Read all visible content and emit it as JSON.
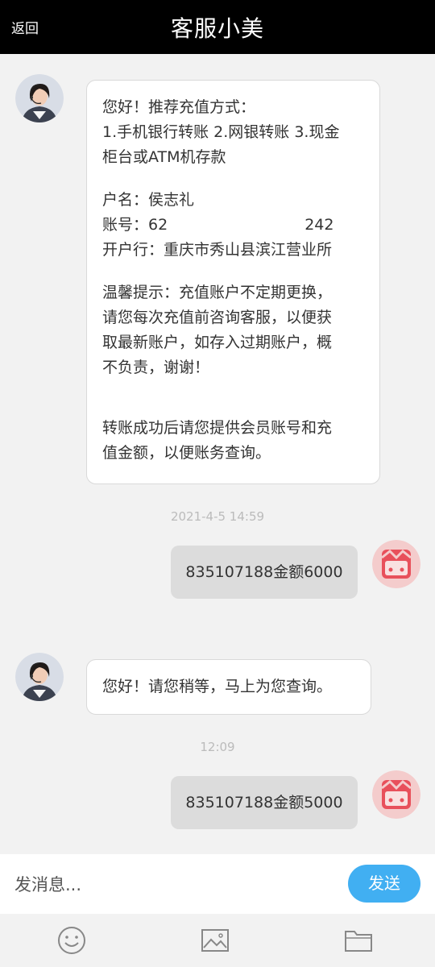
{
  "header": {
    "back_label": "返回",
    "title": "客服小美"
  },
  "messages": {
    "m1": {
      "greeting": "您好！推荐充值方式：",
      "methods_line1": "1.手机银行转账 2.网银转账 3.现金",
      "methods_line2": "柜台或ATM机存款",
      "account_name": "户名：侯志礼",
      "account_no_prefix": "账号：62",
      "account_no_suffix": "242",
      "bank": "开户行：重庆市秀山县滨江营业所",
      "tip_line1": "温馨提示：充值账户不定期更换，",
      "tip_line2": "请您每次充值前咨询客服，以便获",
      "tip_line3": "取最新账户，如存入过期账户，概",
      "tip_line4": "不负责，谢谢！",
      "after_line1": "转账成功后请您提供会员账号和充",
      "after_line2": "值金额，以便账务查询。"
    },
    "time1": "2021-4-5 14:59",
    "m2": "835107188金额6000",
    "m3": "您好！请您稍等，马上为您查询。",
    "time2": "12:09",
    "m4": "835107188金额5000"
  },
  "input": {
    "placeholder": "发消息...",
    "send_label": "发送"
  },
  "toolbar": {
    "icons": [
      "emoji-icon",
      "image-icon",
      "folder-icon"
    ]
  },
  "colors": {
    "header_bg": "#000000",
    "send_button": "#41aff2",
    "user_avatar": "#e8505b",
    "user_avatar_ring": "#f4cccc"
  }
}
